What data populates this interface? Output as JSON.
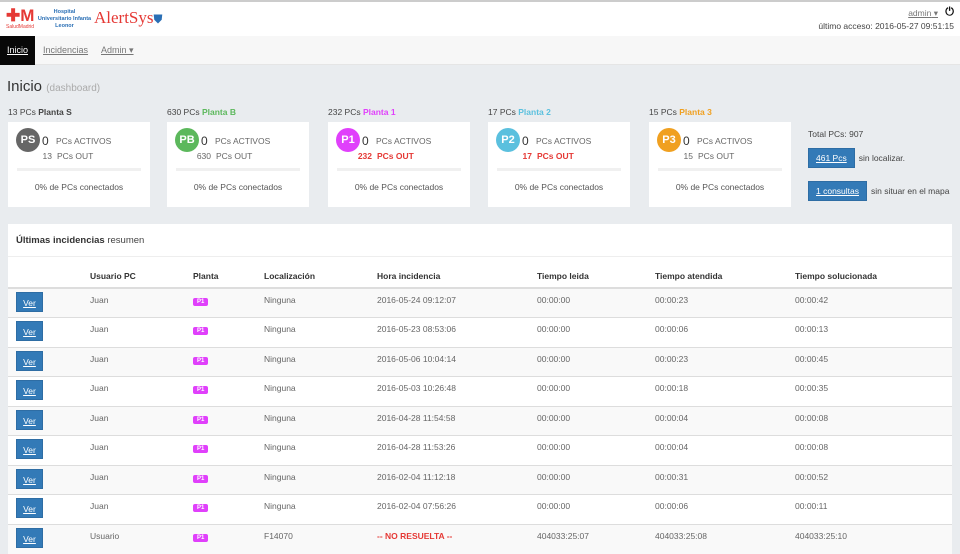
{
  "header": {
    "logo_left": "SaludMadrid",
    "logo_hospital": "Hospital Universitario Infanta Leonor",
    "logo_app": "AlertSys",
    "user": "admin",
    "last_access": "último acceso: 2016-05-27 09:51:15"
  },
  "nav": {
    "items": [
      "Inicio",
      "Incidencias",
      "Admin"
    ]
  },
  "page": {
    "title": "Inicio",
    "subtitle": "(dashboard)"
  },
  "plantas": [
    {
      "count": "13 PCs",
      "name": "Planta S",
      "code": "PS",
      "color": "#666666",
      "activos": "0",
      "activos_label": "PCs ACTIVOS",
      "out": "13",
      "out_label": "PCs OUT",
      "out_alert": false,
      "pct": "0% de PCs conectados"
    },
    {
      "count": "630 PCs",
      "name": "Planta B",
      "code": "PB",
      "color": "#5cb85c",
      "activos": "0",
      "activos_label": "PCs ACTIVOS",
      "out": "630",
      "out_label": "PCs OUT",
      "out_alert": false,
      "pct": "0% de PCs conectados"
    },
    {
      "count": "232 PCs",
      "name": "Planta 1",
      "code": "P1",
      "color": "#e040fb",
      "activos": "0",
      "activos_label": "PCs ACTIVOS",
      "out": "232",
      "out_label": "PCs OUT",
      "out_alert": true,
      "pct": "0% de PCs conectados"
    },
    {
      "count": "17 PCs",
      "name": "Planta 2",
      "code": "P2",
      "color": "#5bc0de",
      "activos": "0",
      "activos_label": "PCs ACTIVOS",
      "out": "17",
      "out_label": "PCs OUT",
      "out_alert": true,
      "pct": "0% de PCs conectados"
    },
    {
      "count": "15 PCs",
      "name": "Planta 3",
      "code": "P3",
      "color": "#f0a020",
      "activos": "0",
      "activos_label": "PCs ACTIVOS",
      "out": "15",
      "out_label": "PCs OUT",
      "out_alert": false,
      "pct": "0% de PCs conectados"
    }
  ],
  "summary": {
    "total": "Total PCs: 907",
    "unlocated_btn": "461 Pcs",
    "unlocated_text": "sin localizar.",
    "consults_btn": "1 consultas",
    "consults_text": "sin situar en el mapa"
  },
  "incidents": {
    "title": "Últimas incidencias",
    "subtitle": "resumen",
    "view_label": "Ver",
    "columns": [
      "",
      "Usuario PC",
      "Planta",
      "Localización",
      "Hora incidencia",
      "Tiempo leida",
      "Tiempo atendida",
      "Tiempo solucionada"
    ],
    "rows": [
      [
        "Juan",
        "P1",
        "Ninguna",
        "2016-05-24 09:12:07",
        "00:00:00",
        "00:00:23",
        "00:00:42"
      ],
      [
        "Juan",
        "P1",
        "Ninguna",
        "2016-05-23 08:53:06",
        "00:00:00",
        "00:00:06",
        "00:00:13"
      ],
      [
        "Juan",
        "P1",
        "Ninguna",
        "2016-05-06 10:04:14",
        "00:00:00",
        "00:00:23",
        "00:00:45"
      ],
      [
        "Juan",
        "P1",
        "Ninguna",
        "2016-05-03 10:26:48",
        "00:00:00",
        "00:00:18",
        "00:00:35"
      ],
      [
        "Juan",
        "P1",
        "Ninguna",
        "2016-04-28 11:54:58",
        "00:00:00",
        "00:00:04",
        "00:00:08"
      ],
      [
        "Juan",
        "P1",
        "Ninguna",
        "2016-04-28 11:53:26",
        "00:00:00",
        "00:00:04",
        "00:00:08"
      ],
      [
        "Juan",
        "P1",
        "Ninguna",
        "2016-02-04 11:12:18",
        "00:00:00",
        "00:00:31",
        "00:00:52"
      ],
      [
        "Juan",
        "P1",
        "Ninguna",
        "2016-02-04 07:56:26",
        "00:00:00",
        "00:00:06",
        "00:00:11"
      ],
      [
        "Usuario",
        "P1",
        "F14070",
        "-- NO RESUELTA --",
        "404033:25:07",
        "404033:25:08",
        "404033:25:10"
      ]
    ]
  }
}
